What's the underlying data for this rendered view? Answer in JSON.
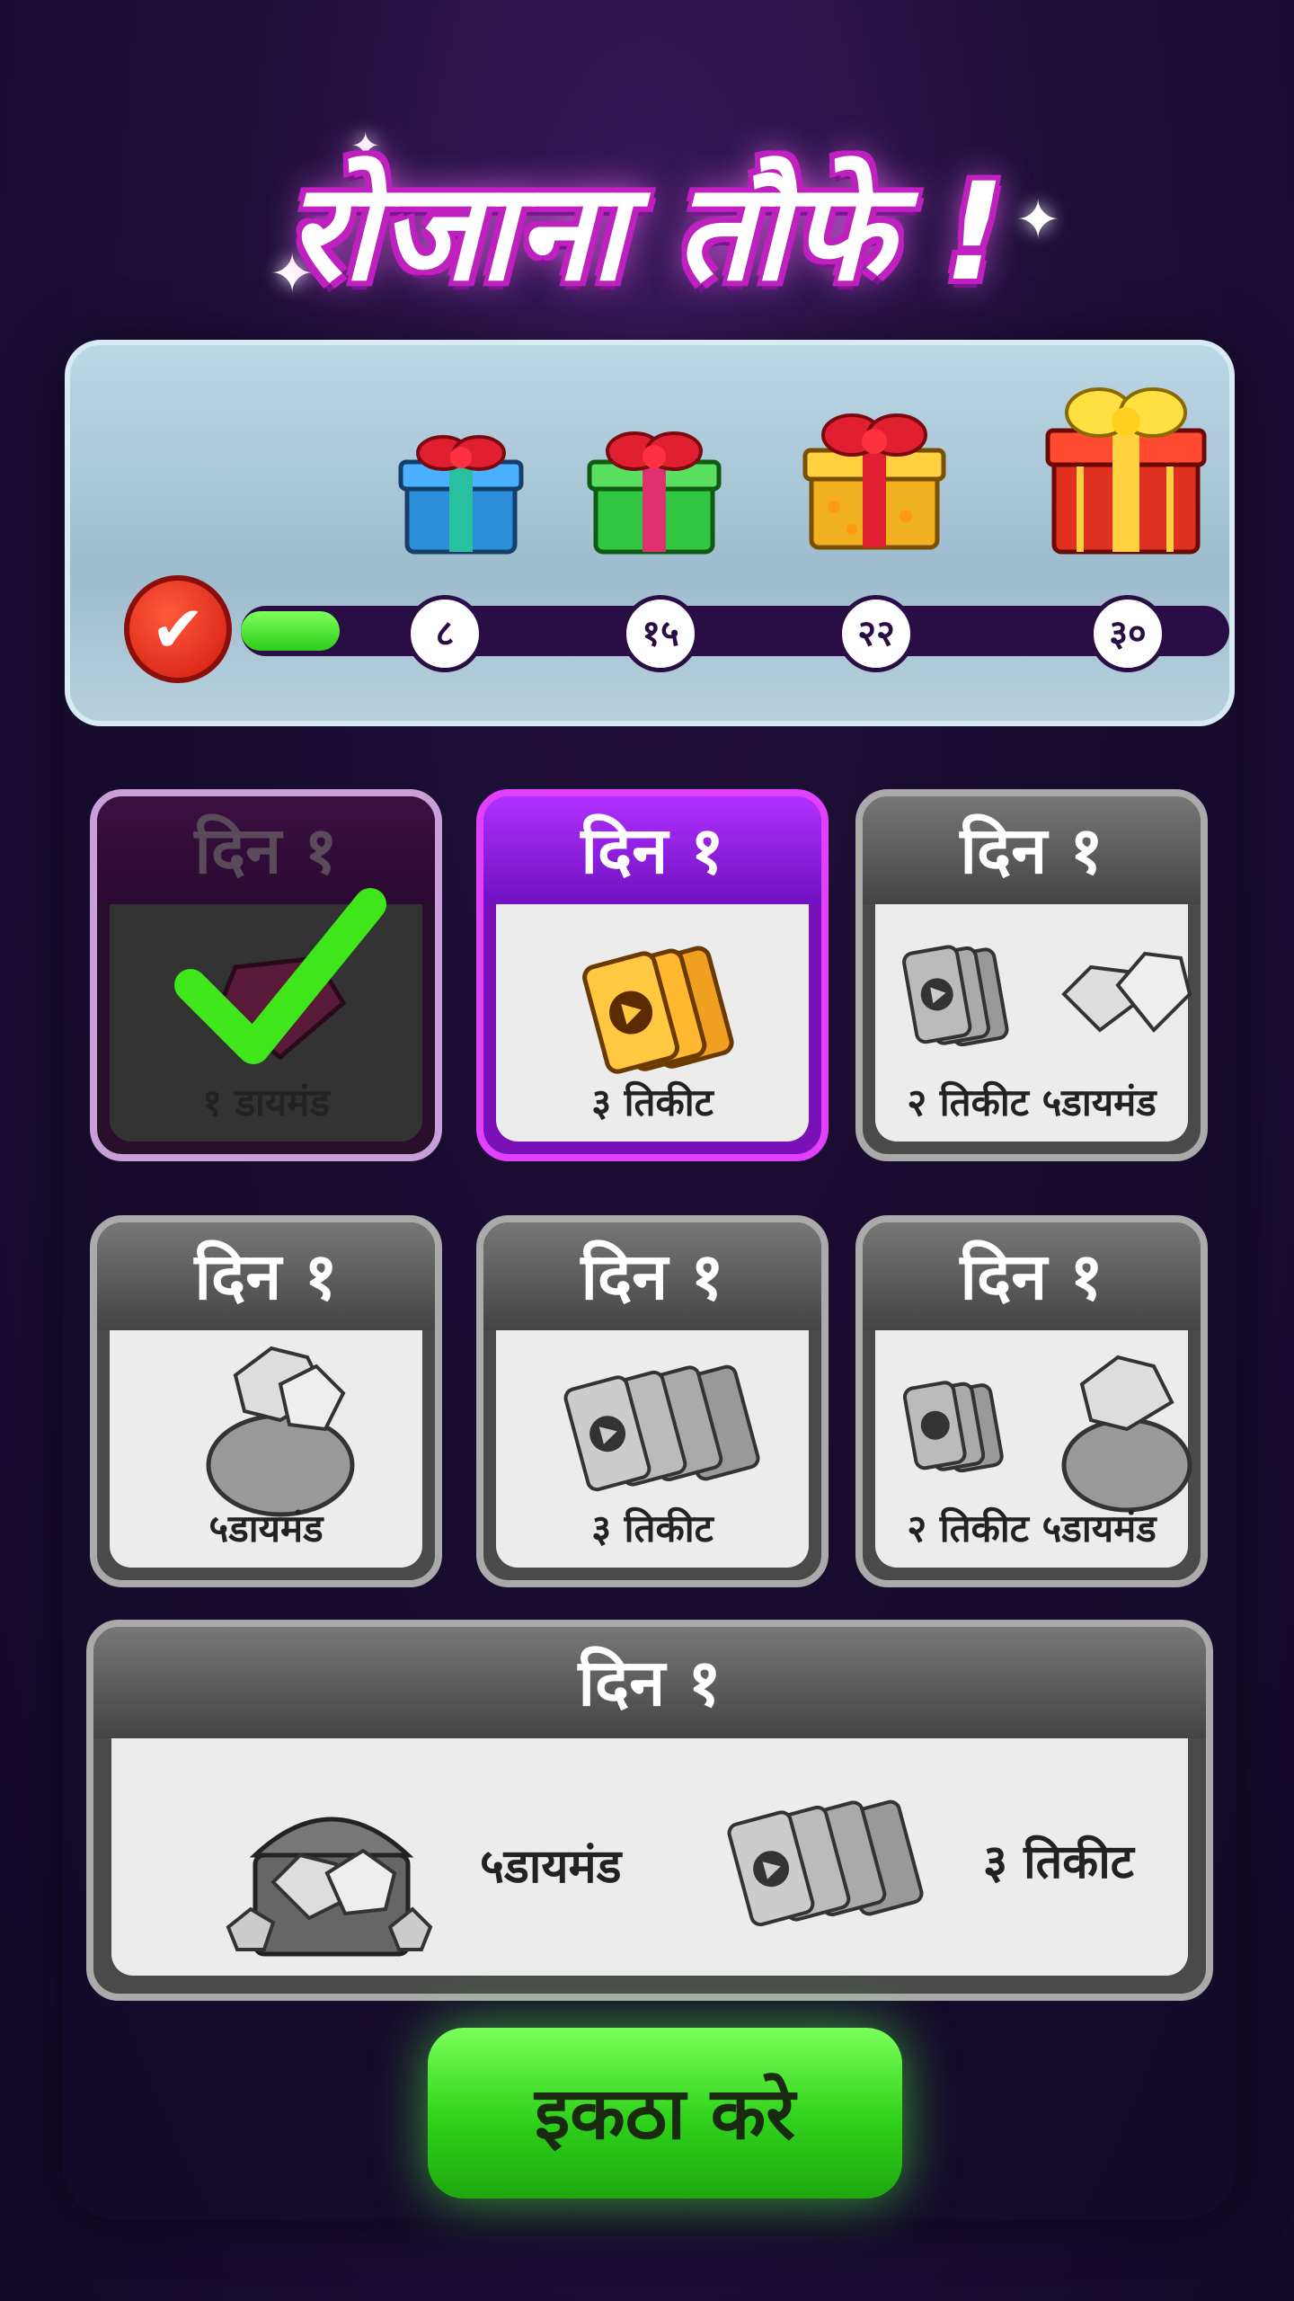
{
  "title": "रोजाना तौफे !",
  "progress": {
    "fill_fraction": 0.1,
    "milestones": [
      "८",
      "१५",
      "२२",
      "३०"
    ]
  },
  "cards": [
    {
      "day": "दिन १",
      "label": "१ डायमंड",
      "state": "claimed"
    },
    {
      "day": "दिन १",
      "label": "३ तिकीट",
      "state": "active"
    },
    {
      "day": "दिन १",
      "label": "२ तिकीट ५डायमंड",
      "state": "locked"
    },
    {
      "day": "दिन १",
      "label": "५डायमंड",
      "state": "locked"
    },
    {
      "day": "दिन १",
      "label": "३ तिकीट",
      "state": "locked"
    },
    {
      "day": "दिन १",
      "label": "२ तिकीट ५डायमंड",
      "state": "locked"
    }
  ],
  "big_card": {
    "day": "दिन १",
    "reward1": "५डायमंड",
    "reward2": "३ तिकीट"
  },
  "collect_label": "इकठा करे",
  "colors": {
    "accent_purple": "#b030ff",
    "collect_green": "#2ed11a",
    "progress_green": "#2ecc1a"
  }
}
